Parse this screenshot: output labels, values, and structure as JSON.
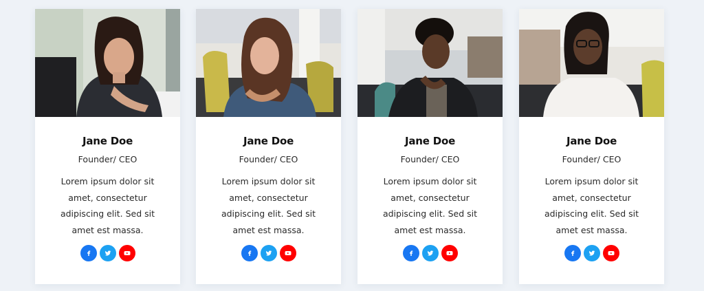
{
  "members": [
    {
      "name": "Jane Doe",
      "role": "Founder/ CEO",
      "bio": "Lorem ipsum dolor sit amet, consectetur adipiscing elit. Sed sit amet est massa."
    },
    {
      "name": "Jane Doe",
      "role": "Founder/ CEO",
      "bio": "Lorem ipsum dolor sit amet, consectetur adipiscing elit. Sed sit amet est massa."
    },
    {
      "name": "Jane Doe",
      "role": "Founder/ CEO",
      "bio": "Lorem ipsum dolor sit amet, consectetur adipiscing elit. Sed sit amet est massa."
    },
    {
      "name": "Jane Doe",
      "role": "Founder/ CEO",
      "bio": "Lorem ipsum dolor sit amet, consectetur adipiscing elit. Sed sit amet est massa."
    }
  ],
  "socials": [
    {
      "icon": "facebook-icon",
      "color": "#1877f2"
    },
    {
      "icon": "twitter-icon",
      "color": "#1da1f2"
    },
    {
      "icon": "youtube-icon",
      "color": "#ff0000"
    }
  ],
  "colors": {
    "page_background": "#eef2f7",
    "card_background": "#ffffff"
  }
}
